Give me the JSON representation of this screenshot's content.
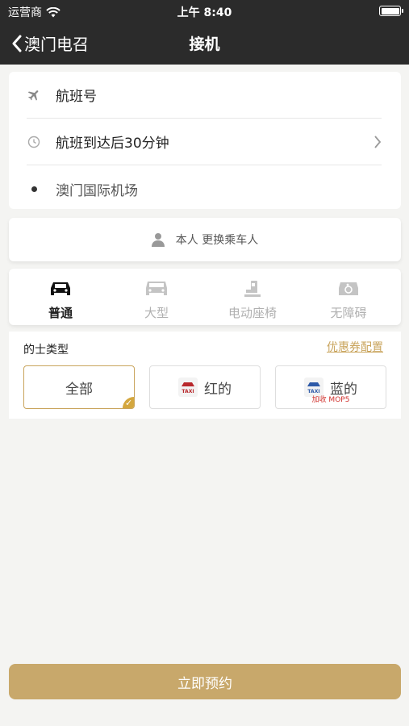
{
  "status_bar": {
    "carrier": "运营商",
    "time": "上午 8:40"
  },
  "navbar": {
    "back_label": "澳门电召",
    "title": "接机"
  },
  "route": {
    "flight_number": "航班号",
    "pickup_time": "航班到达后30分钟",
    "destination": "澳门国际机场"
  },
  "passenger": {
    "label": "本人 更换乘车人"
  },
  "vehicle_types": [
    {
      "label": "普通",
      "icon": "sedan-icon",
      "active": true
    },
    {
      "label": "大型",
      "icon": "van-icon",
      "active": false
    },
    {
      "label": "电动座椅",
      "icon": "power-seat-icon",
      "active": false
    },
    {
      "label": "无障碍",
      "icon": "accessible-icon",
      "active": false
    }
  ],
  "taxi_type": {
    "title": "的士类型",
    "coupon_link": "优惠券配置",
    "options": [
      {
        "label": "全部",
        "selected": true
      },
      {
        "label": "红的",
        "logo_color": "#b8282c",
        "logo_text": "TAXI"
      },
      {
        "label": "蓝的",
        "logo_color": "#2e5aa8",
        "logo_text": "TAXI",
        "note": "加收 MOP5"
      }
    ]
  },
  "book_button": "立即预约",
  "colors": {
    "accent": "#c8a86b",
    "header": "#2b2b2b",
    "selected_border": "#c9a45c"
  }
}
